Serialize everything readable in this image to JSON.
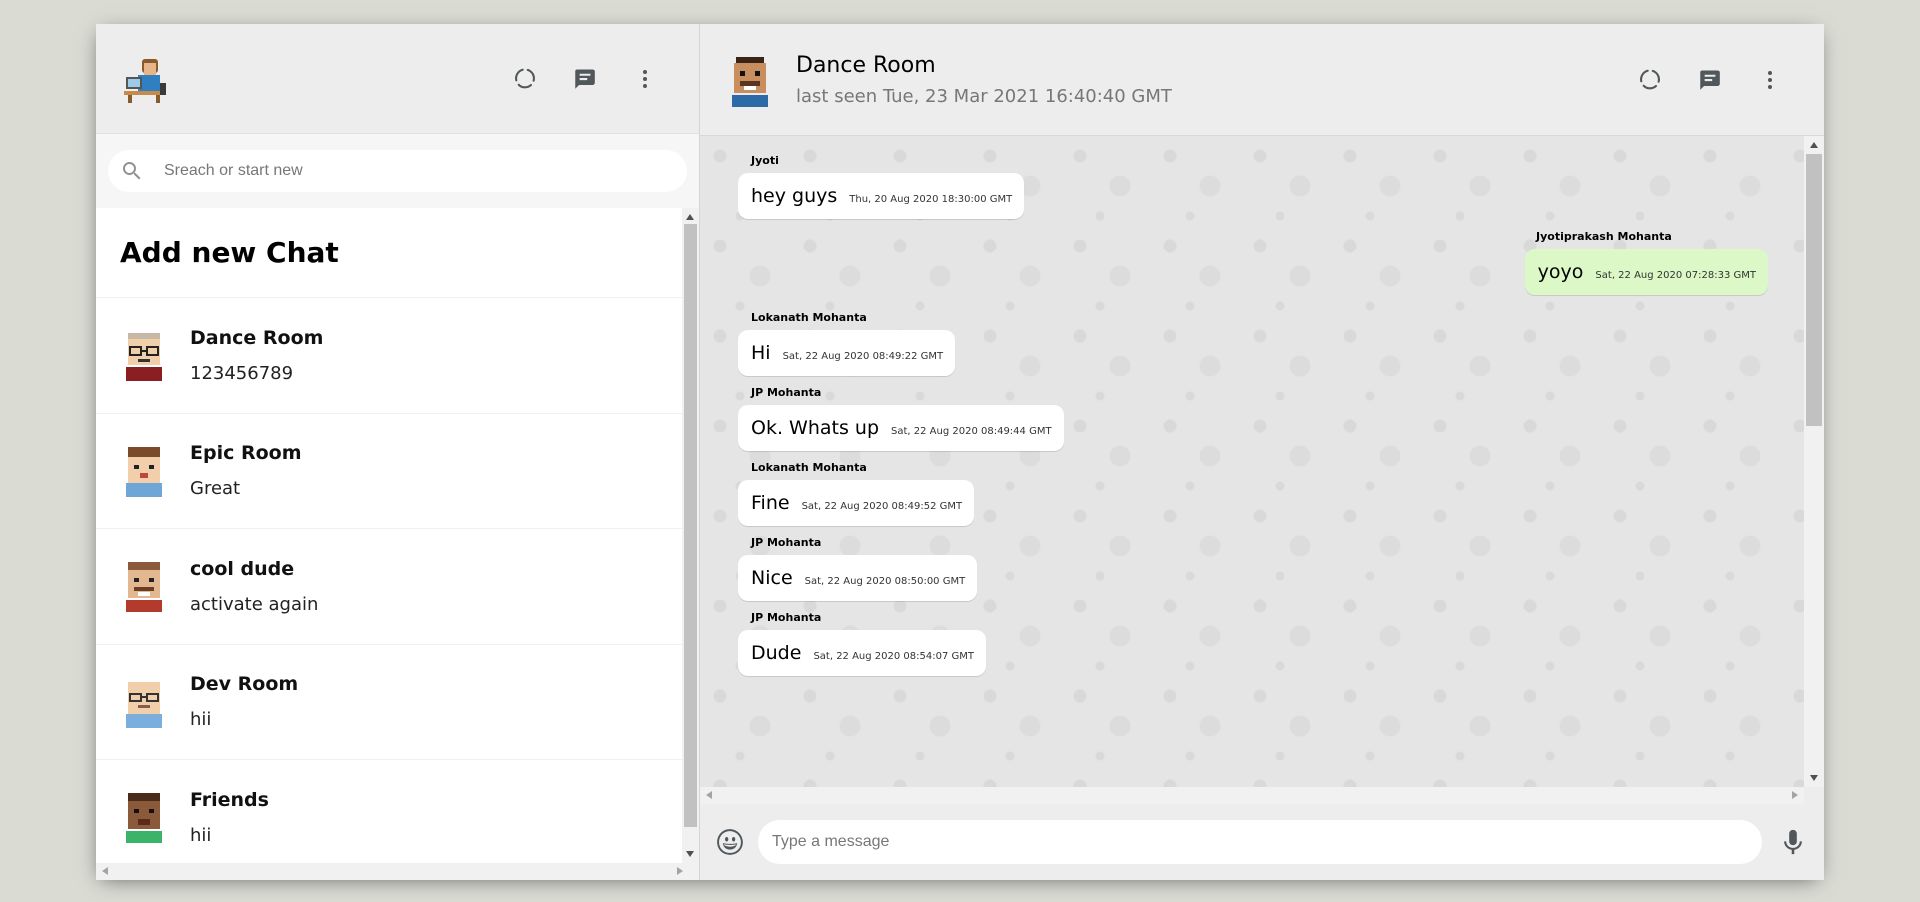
{
  "sidebar": {
    "search": {
      "placeholder": "Sreach or start new"
    },
    "add_chat_label": "Add new Chat",
    "chats": [
      {
        "name": "Dance Room",
        "last": "123456789",
        "avatar": "glasses-avatar"
      },
      {
        "name": "Epic Room",
        "last": "Great",
        "avatar": "brown-hair-avatar"
      },
      {
        "name": "cool dude",
        "last": "activate again",
        "avatar": "mustache-avatar"
      },
      {
        "name": "Dev Room",
        "last": "hii",
        "avatar": "bald-glasses-avatar"
      },
      {
        "name": "Friends",
        "last": "hii",
        "avatar": "dark-skin-avatar"
      }
    ]
  },
  "chat": {
    "title": "Dance Room",
    "subtitle": "last seen Tue, 23 Mar 2021 16:40:40 GMT",
    "messages": [
      {
        "sender": "Jyoti",
        "text": "hey guys",
        "time": "Thu, 20 Aug 2020 18:30:00 GMT",
        "self": false
      },
      {
        "sender": "Jyotiprakash Mohanta",
        "text": "yoyo",
        "time": "Sat, 22 Aug 2020 07:28:33 GMT",
        "self": true
      },
      {
        "sender": "Lokanath Mohanta",
        "text": "Hi",
        "time": "Sat, 22 Aug 2020 08:49:22 GMT",
        "self": false
      },
      {
        "sender": "JP Mohanta",
        "text": "Ok. Whats up",
        "time": "Sat, 22 Aug 2020 08:49:44 GMT",
        "self": false
      },
      {
        "sender": "Lokanath Mohanta",
        "text": "Fine",
        "time": "Sat, 22 Aug 2020 08:49:52 GMT",
        "self": false
      },
      {
        "sender": "JP Mohanta",
        "text": "Nice",
        "time": "Sat, 22 Aug 2020 08:50:00 GMT",
        "self": false
      },
      {
        "sender": "JP Mohanta",
        "text": "Dude",
        "time": "Sat, 22 Aug 2020 08:54:07 GMT",
        "self": false
      }
    ],
    "input": {
      "placeholder": "Type a message"
    }
  },
  "colors": {
    "app_bg": "#dadbd3",
    "panel_header": "#ededed",
    "self_bubble": "#dcf8c6",
    "icon": "#51585c"
  },
  "icons": {
    "status": "status-icon",
    "new_chat": "chat-icon",
    "menu": "more-vert-icon",
    "search": "search-icon",
    "emoji": "emoji-icon",
    "mic": "mic-icon"
  }
}
